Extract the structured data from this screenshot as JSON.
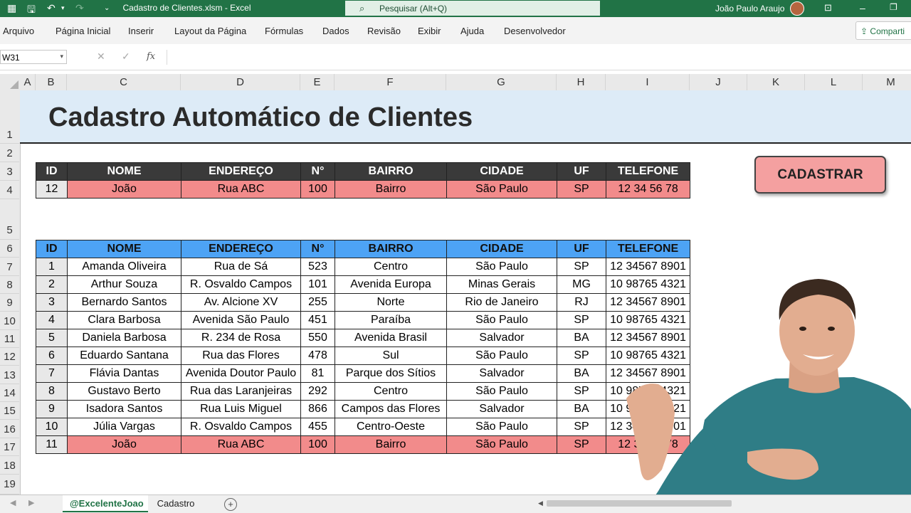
{
  "titlebar": {
    "filename": "Cadastro de Clientes.xlsm",
    "app": "Excel",
    "title": "Cadastro de Clientes.xlsm  -  Excel",
    "search_placeholder": "Pesquisar (Alt+Q)",
    "user_name": "João Paulo Araujo"
  },
  "menu": {
    "items": [
      "Arquivo",
      "Página Inicial",
      "Inserir",
      "Layout da Página",
      "Fórmulas",
      "Dados",
      "Revisão",
      "Exibir",
      "Ajuda",
      "Desenvolvedor"
    ],
    "share": "Comparti"
  },
  "formula_bar": {
    "name_box": "W31",
    "fx": "fx",
    "formula": ""
  },
  "columns": [
    "A",
    "B",
    "C",
    "D",
    "E",
    "F",
    "G",
    "H",
    "I",
    "J",
    "K",
    "L",
    "M"
  ],
  "rows": [
    "1",
    "2",
    "3",
    "4",
    "5",
    "6",
    "7",
    "8",
    "9",
    "10",
    "11",
    "12",
    "13",
    "14",
    "15",
    "16",
    "17",
    "18",
    "19"
  ],
  "sheet": {
    "title": "Cadastro Automático de Clientes",
    "headers": [
      "ID",
      "NOME",
      "ENDEREÇO",
      "N°",
      "BAIRRO",
      "CIDADE",
      "UF",
      "TELEFONE"
    ],
    "form_row": [
      "12",
      "João",
      "Rua ABC",
      "100",
      "Bairro",
      "São Paulo",
      "SP",
      "12 34 56 78"
    ],
    "button_label": "CADASTRAR",
    "records": [
      [
        "1",
        "Amanda Oliveira",
        "Rua de Sá",
        "523",
        "Centro",
        "São Paulo",
        "SP",
        "12 34567 8901"
      ],
      [
        "2",
        "Arthur Souza",
        "R. Osvaldo Campos",
        "101",
        "Avenida Europa",
        "Minas Gerais",
        "MG",
        "10 98765 4321"
      ],
      [
        "3",
        "Bernardo Santos",
        "Av. Alcione XV",
        "255",
        "Norte",
        "Rio de Janeiro",
        "RJ",
        "12 34567 8901"
      ],
      [
        "4",
        "Clara Barbosa",
        "Avenida São Paulo",
        "451",
        "Paraíba",
        "São Paulo",
        "SP",
        "10 98765 4321"
      ],
      [
        "5",
        "Daniela Barbosa",
        "R. 234 de Rosa",
        "550",
        "Avenida Brasil",
        "Salvador",
        "BA",
        "12 34567 8901"
      ],
      [
        "6",
        "Eduardo Santana",
        "Rua das Flores",
        "478",
        "Sul",
        "São Paulo",
        "SP",
        "10 98765 4321"
      ],
      [
        "7",
        "Flávia Dantas",
        "Avenida Doutor Paulo",
        "81",
        "Parque dos Sítios",
        "Salvador",
        "BA",
        "12 34567 8901"
      ],
      [
        "8",
        "Gustavo Berto",
        "Rua das Laranjeiras",
        "292",
        "Centro",
        "São Paulo",
        "SP",
        "10 98765 4321"
      ],
      [
        "9",
        "Isadora Santos",
        "Rua Luis Miguel",
        "866",
        "Campos das Flores",
        "Salvador",
        "BA",
        "10 98765 4321"
      ],
      [
        "10",
        "Júlia Vargas",
        "R. Osvaldo Campos",
        "455",
        "Centro-Oeste",
        "São Paulo",
        "SP",
        "12 34567 8901"
      ],
      [
        "11",
        "João",
        "Rua ABC",
        "100",
        "Bairro",
        "São Paulo",
        "SP",
        "12 34 56 78"
      ]
    ]
  },
  "tabs": {
    "active": "@ExcelenteJoao",
    "other": "Cadastro",
    "add": "+"
  },
  "colors": {
    "excel_green": "#217346",
    "header_dark": "#3a3a3a",
    "header_blue": "#4da3f5",
    "highlight_pink": "#f28b8b",
    "banner_blue": "#ddebf7"
  }
}
